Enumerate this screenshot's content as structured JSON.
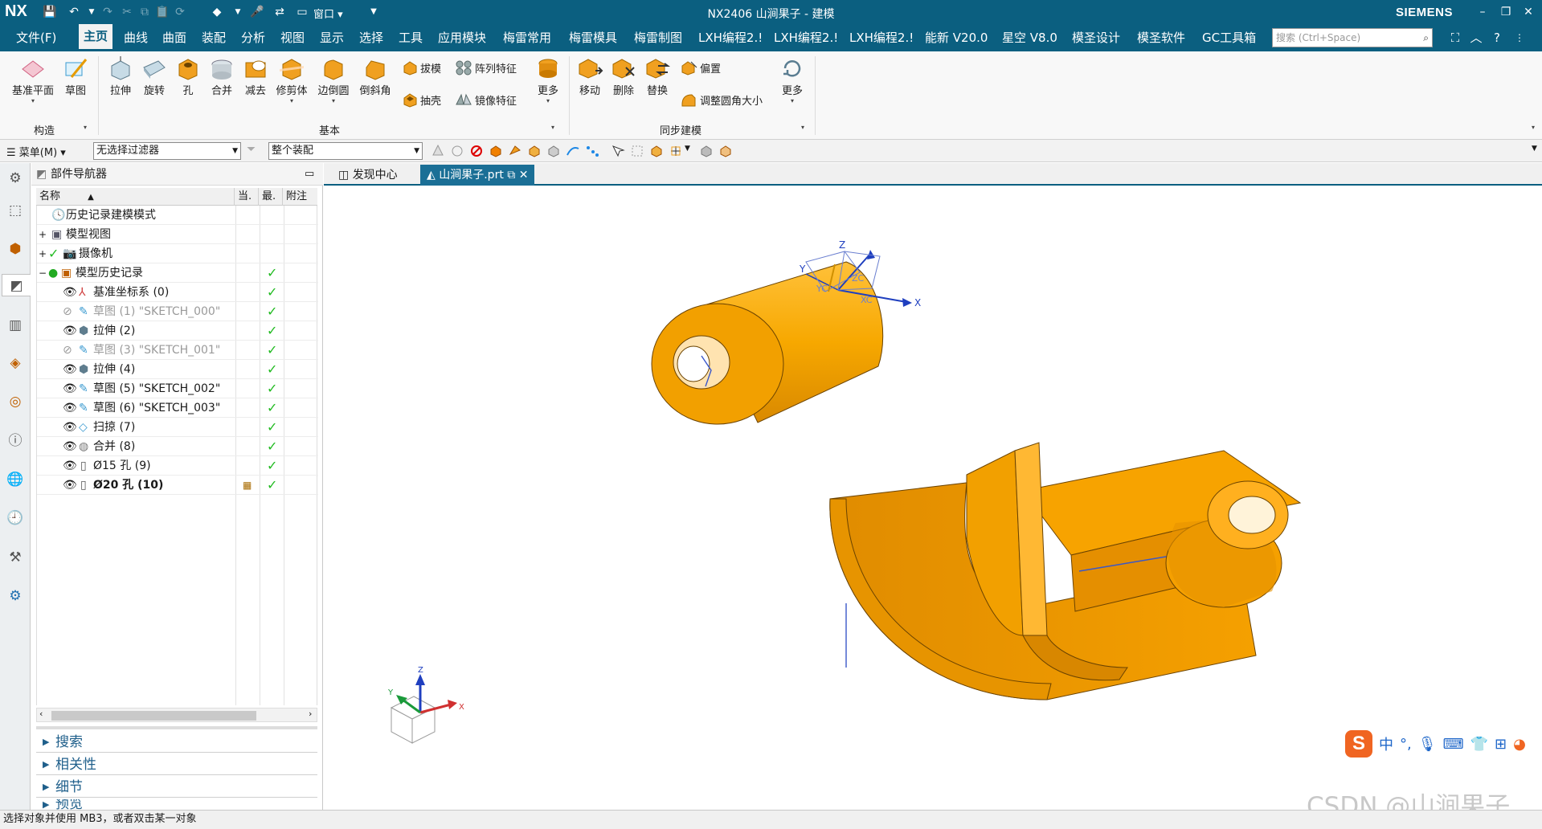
{
  "titlebar": {
    "logo": "NX",
    "window_title": "NX2406 山涧果子 - 建模",
    "brand": "SIEMENS",
    "window_menu": "窗口"
  },
  "tabs": [
    "文件(F)",
    "主页",
    "曲线",
    "曲面",
    "装配",
    "分析",
    "视图",
    "显示",
    "选择",
    "工具",
    "应用模块",
    "梅雷常用",
    "梅雷模具",
    "梅雷制图",
    "LXH编程2.!",
    "LXH编程2.!",
    "LXH编程2.!",
    "能新 V20.0",
    "星空 V8.0",
    "模圣设计",
    "模圣软件",
    "GC工具箱"
  ],
  "active_tab": "主页",
  "search": {
    "placeholder": "搜索 (Ctrl+Space)"
  },
  "ribbon": {
    "construct": {
      "datum_plane": "基准平面",
      "sketch": "草图",
      "group_label": "构造"
    },
    "basic": {
      "extrude": "拉伸",
      "revolve": "旋转",
      "hole": "孔",
      "unite": "合并",
      "subtract": "减去",
      "trim_body": "修剪体",
      "edge_blend": "边倒圆",
      "chamfer": "倒斜角",
      "draft": "拔模",
      "pattern_feature": "阵列特征",
      "shell": "抽壳",
      "mirror_feature": "镜像特征",
      "more": "更多",
      "group_label": "基本"
    },
    "sync": {
      "move": "移动",
      "delete": "删除",
      "replace": "替换",
      "offset": "偏置",
      "resize_blend": "调整圆角大小",
      "more": "更多",
      "group_label": "同步建模"
    }
  },
  "filterbar": {
    "menu": "菜单(M)",
    "type_filter": "无选择过滤器",
    "scope_filter": "整个装配"
  },
  "navigator": {
    "title": "部件导航器",
    "columns": [
      "名称",
      "当.",
      "最.",
      "附注"
    ],
    "rows": [
      {
        "label": "历史记录建模模式",
        "check": ""
      },
      {
        "label": "模型视图",
        "check": ""
      },
      {
        "label": "摄像机",
        "check": ""
      },
      {
        "label": "模型历史记录",
        "check": "✓"
      },
      {
        "label": "基准坐标系 (0)",
        "check": "✓"
      },
      {
        "label": "草图 (1) \"SKETCH_000\"",
        "check": "✓"
      },
      {
        "label": "拉伸 (2)",
        "check": "✓"
      },
      {
        "label": "草图 (3) \"SKETCH_001\"",
        "check": "✓"
      },
      {
        "label": "拉伸 (4)",
        "check": "✓"
      },
      {
        "label": "草图 (5) \"SKETCH_002\"",
        "check": "✓"
      },
      {
        "label": "草图 (6) \"SKETCH_003\"",
        "check": "✓"
      },
      {
        "label": "扫掠 (7)",
        "check": "✓"
      },
      {
        "label": "合并 (8)",
        "check": "✓"
      },
      {
        "label": "Ø15 孔 (9)",
        "check": "✓"
      },
      {
        "label": "Ø20 孔 (10)",
        "check": "✓"
      }
    ],
    "sections": [
      "搜索",
      "相关性",
      "细节",
      "预览"
    ]
  },
  "doc_tabs": [
    "发现中心",
    "山涧果子.prt"
  ],
  "viewport": {
    "axis_labels": {
      "x": "X",
      "y": "Y",
      "z": "Z",
      "xc": "XC",
      "yc": "YC",
      "zc": "ZC"
    },
    "part_color": "#f5a000"
  },
  "status": "选择对象并使用 MB3，或者双击某一对象",
  "ime": {
    "zh": "中"
  },
  "watermark": "CSDN @山涧果子",
  "colors": {
    "brand_blue": "#0b5f80",
    "check_green": "#22bb22",
    "part_orange": "#f5a000"
  }
}
